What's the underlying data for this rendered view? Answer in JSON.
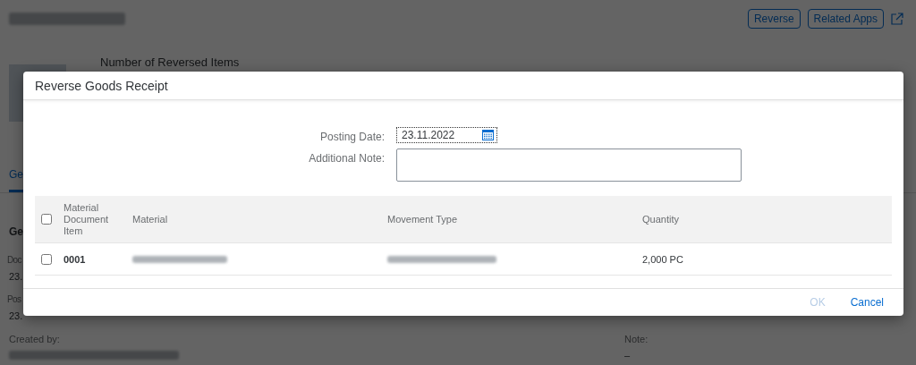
{
  "page": {
    "header_actions": [
      {
        "label": "Reverse"
      },
      {
        "label": "Related Apps"
      }
    ],
    "kpi_label": "Number of Reversed Items",
    "tabs": [
      {
        "label": "Ge",
        "selected": true
      }
    ],
    "section_title": "Ge",
    "fields": [
      {
        "label": "Doc",
        "value": "23."
      },
      {
        "label": "Pos",
        "value": "23."
      }
    ],
    "created_by": {
      "label": "Created by:"
    },
    "note": {
      "label": "Note:",
      "value": "–"
    }
  },
  "dialog": {
    "title": "Reverse Goods Receipt",
    "posting_date": {
      "label": "Posting Date:",
      "value": "23.11.2022"
    },
    "additional_note": {
      "label": "Additional Note:"
    },
    "table": {
      "select_all": {
        "checked": false
      },
      "columns": [
        "Material Document Item",
        "Material",
        "Movement Type",
        "Quantity"
      ],
      "rows": [
        {
          "checked": false,
          "item": "0001",
          "quantity": "2,000 PC"
        }
      ]
    },
    "buttons": [
      {
        "label": "OK",
        "disabled": true
      },
      {
        "label": "Cancel",
        "disabled": false
      }
    ]
  }
}
